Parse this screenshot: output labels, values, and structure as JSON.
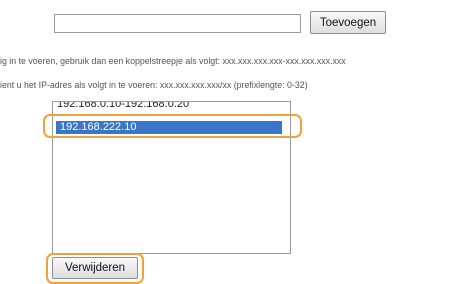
{
  "form": {
    "ip_input_value": "",
    "add_button": "Toevoegen",
    "delete_button": "Verwijderen"
  },
  "hints": {
    "range_hint": "ig in te voeren, gebruik dan een koppelstreepje als volgt: xxx.xxx.xxx.xxx-xxx.xxx.xxx.xxx",
    "prefix_hint": "ient u het IP-adres als volgt in te voeren: xxx.xxx.xxx.xxx/xx (prefixlengte: 0-32)"
  },
  "address_list": {
    "items": [
      "192.168.0.10-192.168.0.20",
      "192.168.222.10"
    ],
    "selected": "192.168.222.10"
  },
  "colors": {
    "highlight": "#f2a23a",
    "selection": "#3a76c8"
  }
}
